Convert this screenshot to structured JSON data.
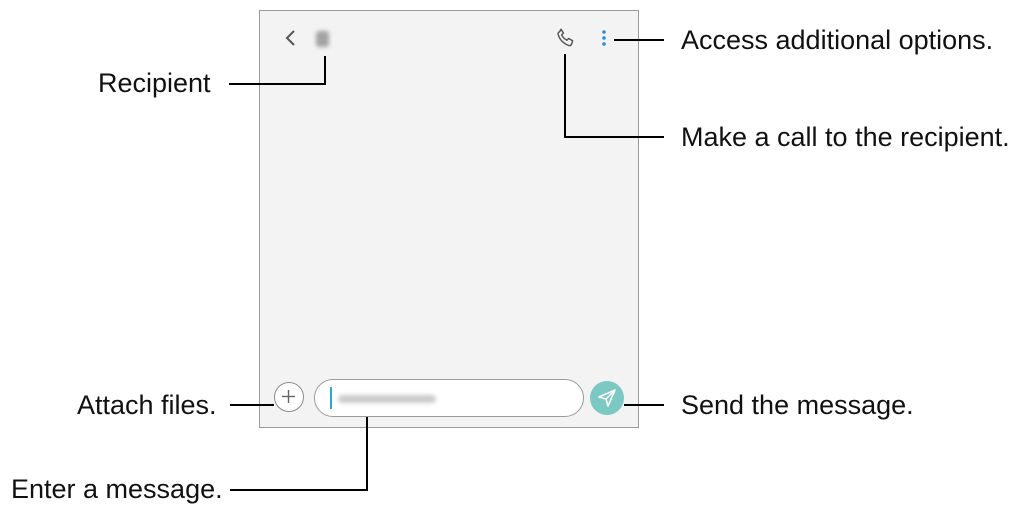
{
  "screen": {
    "icons": {
      "back": "chevron-left-icon",
      "call": "phone-icon",
      "more": "more-vertical-icon",
      "attach": "plus-icon",
      "send": "send-icon"
    },
    "colors": {
      "screen_bg": "#f3f3f3",
      "send_button": "#7cc8c3",
      "cursor": "#2aa9c8"
    }
  },
  "callouts": {
    "recipient": "Recipient",
    "options": "Access additional options.",
    "call": "Make a call to the recipient.",
    "attach": "Attach files.",
    "send": "Send the message.",
    "enter": "Enter a message."
  }
}
